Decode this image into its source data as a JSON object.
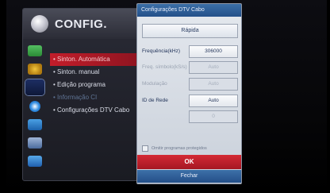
{
  "config": {
    "title": "CONFIG.",
    "category_icons": [
      {
        "name": "picture-icon",
        "color": "#3aa54a"
      },
      {
        "name": "audio-icon",
        "color": "#d8a21c"
      },
      {
        "name": "setup-icon",
        "color": "#c6cad6",
        "selected": true
      },
      {
        "name": "time-icon",
        "color": "#1e7bd6"
      },
      {
        "name": "lock-icon",
        "color": "#2f8bd1"
      },
      {
        "name": "option-icon",
        "color": "#6b8fc2"
      },
      {
        "name": "network-icon",
        "color": "#3b8bd1"
      }
    ],
    "items": [
      {
        "label": "• Sinton. Automática",
        "state": "active"
      },
      {
        "label": "• Sinton. manual",
        "state": "normal"
      },
      {
        "label": "• Edição programa",
        "state": "normal"
      },
      {
        "label": "• Informação CI",
        "state": "disabled"
      },
      {
        "label": "• Configurações DTV Cabo",
        "state": "normal"
      }
    ]
  },
  "dialog": {
    "title": "Configurações DTV Cabo",
    "mode": "Rápida",
    "fields": [
      {
        "label": "Frequência(kHz)",
        "value": "306000",
        "state": "normal"
      },
      {
        "label": "Freq. símbolo(kS/s)",
        "value": "Auto",
        "state": "disabled"
      },
      {
        "label": "Modulação",
        "value": "Auto",
        "state": "disabled"
      },
      {
        "label": "ID de Rede",
        "value": "Auto",
        "state": "normal"
      },
      {
        "label": "",
        "value": "0",
        "state": "disabled"
      }
    ],
    "checkbox_label": "Omitir programas protegidos",
    "ok_label": "OK",
    "close_label": "Fechar"
  }
}
